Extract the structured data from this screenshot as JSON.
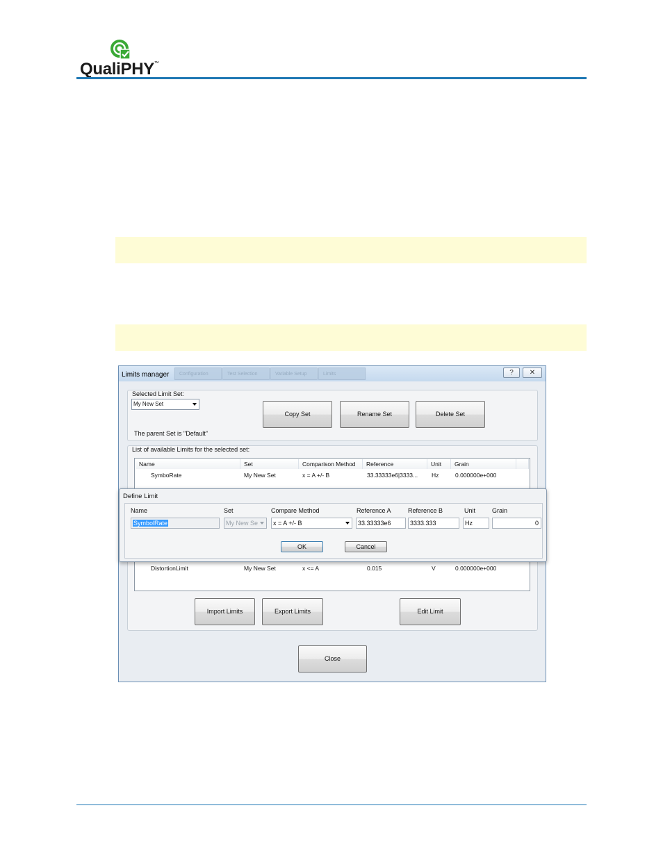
{
  "brand": {
    "name": "QualiPHY",
    "tm": "™",
    "accent": "#1f78b4",
    "icon": "qualiphy-logo-icon"
  },
  "window": {
    "title": "Limits manager",
    "ghost_tabs": [
      "Configuration",
      "Test Selection",
      "Variable Setup",
      "Limits"
    ],
    "help_button": "?",
    "close_button": "✕"
  },
  "limit_set": {
    "label": "Selected Limit Set:",
    "selected": "My New Set",
    "parent_note": "The parent Set is \"Default\"",
    "copy_button": "Copy Set",
    "rename_button": "Rename Set",
    "delete_button": "Delete Set"
  },
  "limits_list": {
    "label": "List of available Limits for the selected set:",
    "columns": [
      "Name",
      "Set",
      "Comparison Method",
      "Reference",
      "Unit",
      "Grain"
    ],
    "rows": [
      {
        "name": "SymboRate",
        "set": "My New Set",
        "method": "x = A +/- B",
        "reference": "33.33333e6|3333...",
        "unit": "Hz",
        "grain": "0.000000e+000"
      },
      {
        "name": "DistortionLimit",
        "set": "My New Set",
        "method": "x <= A",
        "reference": "0.015",
        "unit": "V",
        "grain": "0.000000e+000"
      }
    ],
    "import_button": "Import Limits",
    "export_button": "Export Limits",
    "edit_button": "Edit Limit"
  },
  "close_button": "Close",
  "define_limit": {
    "title": "Define Limit",
    "labels": {
      "name": "Name",
      "set": "Set",
      "method": "Compare Method",
      "ref_a": "Reference A",
      "ref_b": "Reference B",
      "unit": "Unit",
      "grain": "Grain"
    },
    "values": {
      "name": "SymbolRate",
      "set": "My New Se",
      "method": "x = A +/- B",
      "ref_a": "33.33333e6",
      "ref_b": "3333.333",
      "unit": "Hz",
      "grain": "0"
    },
    "ok_button": "OK",
    "cancel_button": "Cancel"
  }
}
